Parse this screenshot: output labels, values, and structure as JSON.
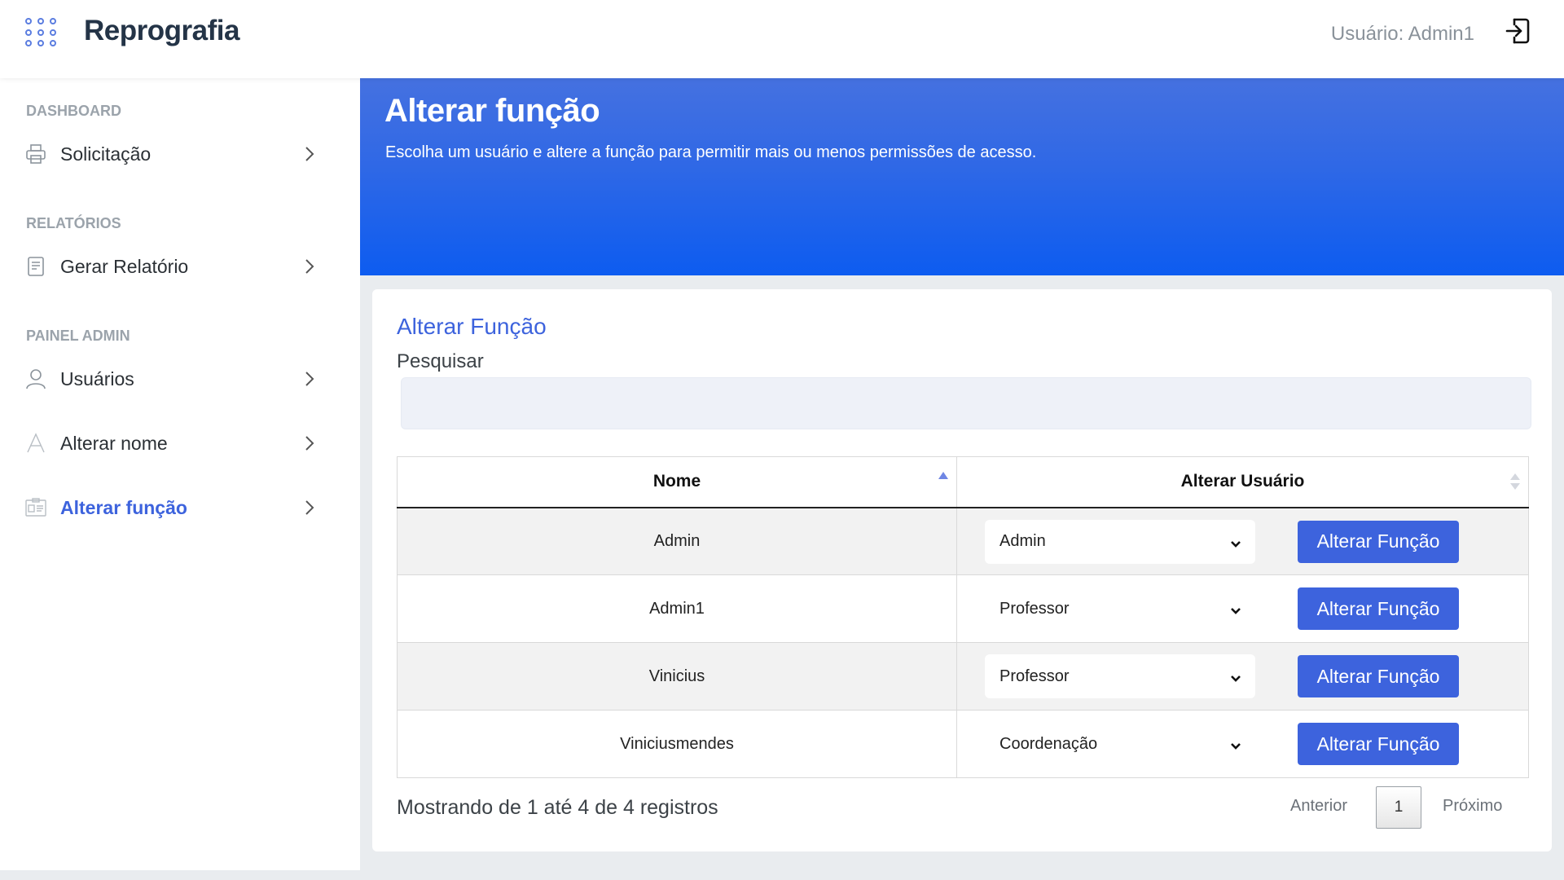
{
  "header": {
    "brand": "Reprografia",
    "user_label": "Usuário: Admin1",
    "menu_icon": "apps-grid-icon",
    "logout_icon": "logout-icon"
  },
  "sidebar": {
    "sections": [
      {
        "heading": "DASHBOARD",
        "items": [
          {
            "label": "Solicitação",
            "icon": "printer-icon"
          }
        ]
      },
      {
        "heading": "RELATÓRIOS",
        "items": [
          {
            "label": "Gerar Relatório",
            "icon": "report-icon"
          }
        ]
      },
      {
        "heading": "PAINEL ADMIN",
        "items": [
          {
            "label": "Usuários",
            "icon": "user-icon"
          },
          {
            "label": "Alterar nome",
            "icon": "font-icon"
          },
          {
            "label": "Alterar função",
            "icon": "id-card-icon",
            "active": true
          }
        ]
      }
    ]
  },
  "hero": {
    "title": "Alterar função",
    "subtitle": "Escolha um usuário e altere a função para permitir mais ou menos permissões de acesso."
  },
  "card": {
    "title": "Alterar Função",
    "search_label": "Pesquisar",
    "search_value": ""
  },
  "table": {
    "columns": [
      "Nome",
      "Alterar Usuário"
    ],
    "rows": [
      {
        "name": "Admin",
        "role": "Admin",
        "button": "Alterar Função"
      },
      {
        "name": "Admin1",
        "role": "Professor",
        "button": "Alterar Função"
      },
      {
        "name": "Vinicius",
        "role": "Professor",
        "button": "Alterar Função"
      },
      {
        "name": "Viniciusmendes",
        "role": "Coordenação",
        "button": "Alterar Função"
      }
    ]
  },
  "footer": {
    "info": "Mostrando de 1 até 4 de 4 registros",
    "prev": "Anterior",
    "page": "1",
    "next": "Próximo"
  },
  "colors": {
    "accent": "#3d63dd",
    "hero_top": "#4571e0",
    "hero_bottom": "#0d5cf0"
  }
}
